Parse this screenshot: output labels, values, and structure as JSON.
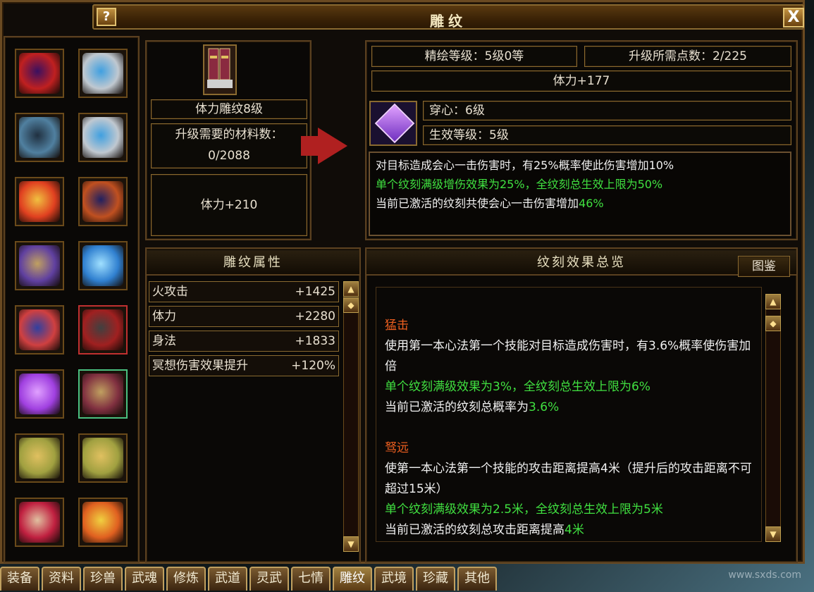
{
  "window": {
    "title": "雕纹",
    "help_label": "?",
    "close_label": "X"
  },
  "equipment_slots": [
    {
      "name": "weapon-blade-icon",
      "colors": [
        "#c02020",
        "#3a1060"
      ]
    },
    {
      "name": "ring-icon",
      "colors": [
        "#c0c8d0",
        "#40a0e0"
      ]
    },
    {
      "name": "armor-icon",
      "colors": [
        "#5080a0",
        "#203040"
      ]
    },
    {
      "name": "ring-icon",
      "colors": [
        "#c0c8d0",
        "#40a0e0"
      ]
    },
    {
      "name": "scroll-icon",
      "colors": [
        "#e04020",
        "#f0c040"
      ]
    },
    {
      "name": "bracer-icon",
      "colors": [
        "#c05020",
        "#202060"
      ]
    },
    {
      "name": "belt-icon",
      "colors": [
        "#6040a0",
        "#c0a060"
      ]
    },
    {
      "name": "needle-icon",
      "colors": [
        "#3080d0",
        "#a0e0ff"
      ]
    },
    {
      "name": "shoulder-armor-icon",
      "colors": [
        "#d04040",
        "#3040a0"
      ]
    },
    {
      "name": "glove-icon",
      "colors": [
        "#a02020",
        "#404040"
      ]
    },
    {
      "name": "sword-icon",
      "colors": [
        "#a040e0",
        "#e0a0ff"
      ]
    },
    {
      "name": "boots-icon",
      "colors": [
        "#803040",
        "#c0a060"
      ]
    },
    {
      "name": "jade-pendant-icon",
      "colors": [
        "#a0a040",
        "#e0c060"
      ]
    },
    {
      "name": "jade-pendant-icon",
      "colors": [
        "#a0a040",
        "#e0c060"
      ]
    },
    {
      "name": "necklace-icon",
      "colors": [
        "#c02040",
        "#e0c0a0"
      ]
    },
    {
      "name": "talisman-icon",
      "colors": [
        "#e06020",
        "#f0d040"
      ]
    }
  ],
  "item": {
    "name": "体力雕纹8级",
    "materials_label": "升级需要的材料数：",
    "materials_value": "0/2088",
    "stat": "体力+210"
  },
  "upgrade": {
    "refine_level": "精绘等级：5级0等",
    "points_needed": "升级所需点数：2/225",
    "stat": "体力+177",
    "skill_name": "穿心：6级",
    "effect_level": "生效等级：5级"
  },
  "description": {
    "line1": "对目标造成会心一击伤害时，有25%概率使此伤害增加10%",
    "line2": "单个纹刻满级增伤效果为25%，全纹刻总生效上限为50%",
    "line3_prefix": "当前已激活的纹刻共使会心一击伤害增加",
    "line3_value": "46%"
  },
  "attributes": {
    "heading": "雕纹属性",
    "items": [
      {
        "label": "火攻击",
        "value": "+1425"
      },
      {
        "label": "体力",
        "value": "+2280"
      },
      {
        "label": "身法",
        "value": "+1833"
      },
      {
        "label": "冥想伤害效果提升",
        "value": "+120%"
      }
    ]
  },
  "overview": {
    "heading": "纹刻效果总览",
    "catalog_button": "图鉴",
    "sections": [
      {
        "title": "猛击",
        "desc": "使用第一本心法第一个技能对目标造成伤害时，有3.6%概率使伤害加倍",
        "cap": "单个纹刻满级效果为3%，全纹刻总生效上限为6%",
        "current_prefix": "当前已激活的纹刻总概率为",
        "current_value": "3.6%"
      },
      {
        "title": "驽远",
        "desc": "使第一本心法第一个技能的攻击距离提高4米（提升后的攻击距离不可超过15米）",
        "cap": "单个纹刻满级效果为2.5米，全纹刻总生效上限为5米",
        "current_prefix": "当前已激活的纹刻总攻击距离提高",
        "current_value": "4米"
      }
    ]
  },
  "tabs": [
    "装备",
    "资料",
    "珍兽",
    "武魂",
    "修炼",
    "武道",
    "灵武",
    "七情",
    "雕纹",
    "武境",
    "珍藏",
    "其他"
  ],
  "active_tab": "雕纹",
  "watermark": "www.sxds.com"
}
